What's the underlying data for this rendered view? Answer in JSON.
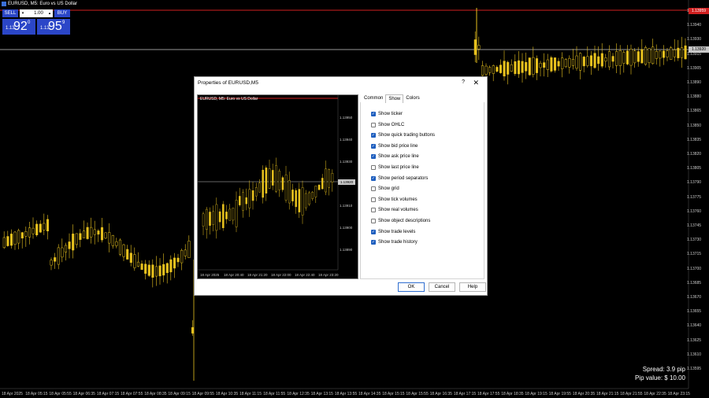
{
  "colors": {
    "background": "#000000",
    "candle": "#e8c21e",
    "bid_line": "#c8c8c8",
    "ask_line": "#d02020",
    "button": "#2b46c8"
  },
  "chart_header": {
    "title": "EURUSD, M5: Euro vs US Dollar"
  },
  "trade_panel": {
    "sell_label": "SELL",
    "buy_label": "BUY",
    "lot_value": "1.00",
    "bid_prefix": "1.13",
    "bid_big": "92",
    "bid_sup": "0",
    "ask_prefix": "1.13",
    "ask_big": "95",
    "ask_sup": "9"
  },
  "price_axis": [
    "1.13950",
    "1.13940",
    "1.13930",
    "1.13915",
    "1.13905",
    "1.13890",
    "1.13880",
    "1.13865",
    "1.13850",
    "1.13835",
    "1.13820",
    "1.13805",
    "1.13790",
    "1.13775",
    "1.13760",
    "1.13745",
    "1.13730",
    "1.13715",
    "1.13700",
    "1.13685",
    "1.13670",
    "1.13655",
    "1.13640",
    "1.13625",
    "1.13610",
    "1.13595"
  ],
  "price_tags": {
    "ask": "1.13959",
    "bid": "1.13920"
  },
  "time_axis": [
    "18 Apr 2025",
    "18 Apr 05:15",
    "18 Apr 05:55",
    "18 Apr 06:35",
    "18 Apr 07:15",
    "18 Apr 07:55",
    "18 Apr 08:35",
    "18 Apr 09:15",
    "18 Apr 09:55",
    "18 Apr 10:35",
    "18 Apr 11:15",
    "18 Apr 11:55",
    "18 Apr 12:35",
    "18 Apr 13:15",
    "18 Apr 13:55",
    "18 Apr 14:35",
    "18 Apr 15:15",
    "18 Apr 15:55",
    "18 Apr 16:35",
    "18 Apr 17:15",
    "18 Apr 17:55",
    "18 Apr 18:35",
    "18 Apr 19:15",
    "18 Apr 19:55",
    "18 Apr 20:35",
    "18 Apr 21:15",
    "18 Apr 21:55",
    "18 Apr 22:35",
    "18 Apr 23:15"
  ],
  "spread_info": {
    "spread": "Spread:  3.9  pip",
    "pip_value": "Pip value:  $ 10.00"
  },
  "dialog": {
    "title": "Properties of EURUSD,M5",
    "help_glyph": "?",
    "close_glyph": "✕",
    "tabs": [
      "Common",
      "Show",
      "Colors"
    ],
    "active_tab": "Show",
    "options": [
      {
        "label": "Show ticker",
        "checked": true
      },
      {
        "label": "Show OHLC",
        "checked": false
      },
      {
        "label": "Show quick trading buttons",
        "checked": true
      },
      {
        "label": "Show bid price line",
        "checked": true
      },
      {
        "label": "Show ask price line",
        "checked": true
      },
      {
        "label": "Show last price line",
        "checked": false
      },
      {
        "label": "Show period separators",
        "checked": true
      },
      {
        "label": "Show grid",
        "checked": false
      },
      {
        "label": "Show tick volumes",
        "checked": false
      },
      {
        "label": "Show real volumes",
        "checked": false
      },
      {
        "label": "Show object descriptions",
        "checked": false
      },
      {
        "label": "Show trade levels",
        "checked": true
      },
      {
        "label": "Show trade history",
        "checked": true
      }
    ],
    "ok_label": "OK",
    "cancel_label": "Cancel",
    "help_label": "Help",
    "preview": {
      "title": "EURUSD, M5:  Euro vs US Dollar",
      "price_axis": [
        "1.13950",
        "1.13940",
        "1.13930",
        "1.13920",
        "1.13910",
        "1.13900",
        "1.13890"
      ],
      "price_tag": "1.13920",
      "time_axis": [
        "18 Apr 2025",
        "18 Apr 20:40",
        "18 Apr 21:20",
        "18 Apr 22:00",
        "18 Apr 22:40",
        "18 Apr 23:20"
      ]
    }
  }
}
